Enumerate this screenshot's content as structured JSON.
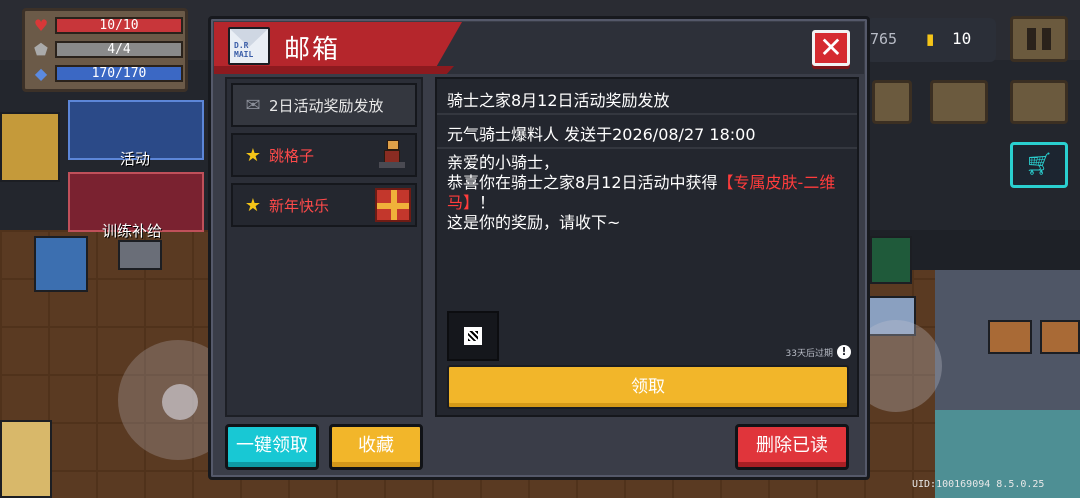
{
  "hud": {
    "hp": "10/10",
    "armor": "4/4",
    "energy": "170/170",
    "activity_label": "活动",
    "training_label": "训练补给",
    "coins_partial": "765",
    "gems": "10",
    "pause_icon": "pause-icon"
  },
  "mailbox": {
    "title": "邮箱",
    "mail_icon_text": "D.R\nMAIL",
    "close_icon": "close-x-icon",
    "list": [
      {
        "label": "2日活动奖励发放",
        "icon": "opened-mail-icon",
        "read": true
      },
      {
        "label": "跳格子",
        "icon": "star-icon",
        "read": false,
        "thumb": "knight-character-icon"
      },
      {
        "label": "新年快乐",
        "icon": "star-icon",
        "read": false,
        "thumb": "gift-box-icon"
      }
    ],
    "detail": {
      "title": "骑士之家8月12日活动奖励发放",
      "sender": "元气骑士爆料人 发送于2026/08/27 18:00",
      "body_line1": "亲爱的小骑士，",
      "body_line2_pre": "恭喜你在骑士之家8月12日活动中获得",
      "body_highlight": "【专属皮肤-二维马】",
      "body_line2_post": "！",
      "body_line3": "这是你的奖励，请收下~",
      "attachment_icon": "qr-code-icon",
      "expire_text": "33天后过期",
      "claim_label": "领取"
    },
    "buttons": {
      "one_click_claim": "一键领取",
      "favorite": "收藏",
      "delete_read": "删除已读"
    }
  },
  "footer": {
    "uid": "UID:100169094 8.5.0.25"
  },
  "colors": {
    "ribbon": "#b5262c",
    "close_button": "#d52a2f",
    "claim_button": "#f2b62a",
    "oneclick_button": "#18c8d4",
    "delete_button": "#e0353b",
    "highlight_text": "#ff3c3c"
  }
}
